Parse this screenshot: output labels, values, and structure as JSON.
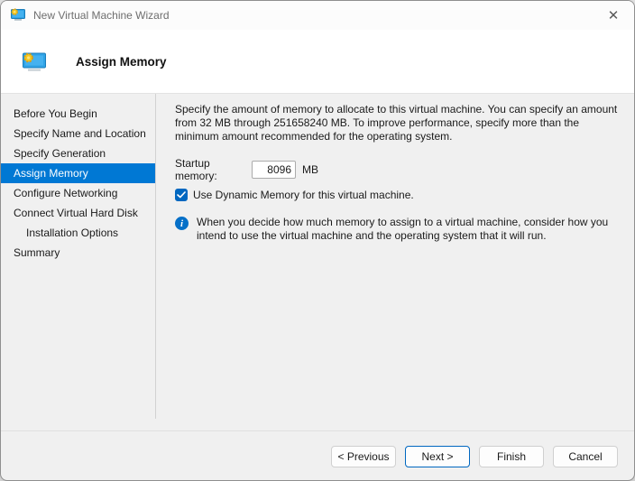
{
  "window": {
    "title": "New Virtual Machine Wizard",
    "close_glyph": "✕"
  },
  "header": {
    "title": "Assign Memory"
  },
  "sidebar": {
    "items": [
      {
        "label": "Before You Begin",
        "selected": false,
        "indented": false
      },
      {
        "label": "Specify Name and Location",
        "selected": false,
        "indented": false
      },
      {
        "label": "Specify Generation",
        "selected": false,
        "indented": false
      },
      {
        "label": "Assign Memory",
        "selected": true,
        "indented": false
      },
      {
        "label": "Configure Networking",
        "selected": false,
        "indented": false
      },
      {
        "label": "Connect Virtual Hard Disk",
        "selected": false,
        "indented": false
      },
      {
        "label": "Installation Options",
        "selected": false,
        "indented": true
      },
      {
        "label": "Summary",
        "selected": false,
        "indented": false
      }
    ]
  },
  "content": {
    "description": "Specify the amount of memory to allocate to this virtual machine. You can specify an amount from 32 MB through 251658240 MB. To improve performance, specify more than the minimum amount recommended for the operating system.",
    "startup_memory_label": "Startup memory:",
    "startup_memory_value": "8096",
    "unit_label": "MB",
    "dynamic_memory_label": "Use Dynamic Memory for this virtual machine.",
    "dynamic_memory_checked": true,
    "info_text": "When you decide how much memory to assign to a virtual machine, consider how you intend to use the virtual machine and the operating system that it will run."
  },
  "footer": {
    "previous_label": "< Previous",
    "next_label": "Next >",
    "finish_label": "Finish",
    "cancel_label": "Cancel"
  },
  "colors": {
    "selection_accent": "#0078d4",
    "checkbox_accent": "#0067c0",
    "info_icon": "#0670c8",
    "default_button_border": "#0067c0",
    "body_background": "#f0f0f0"
  }
}
